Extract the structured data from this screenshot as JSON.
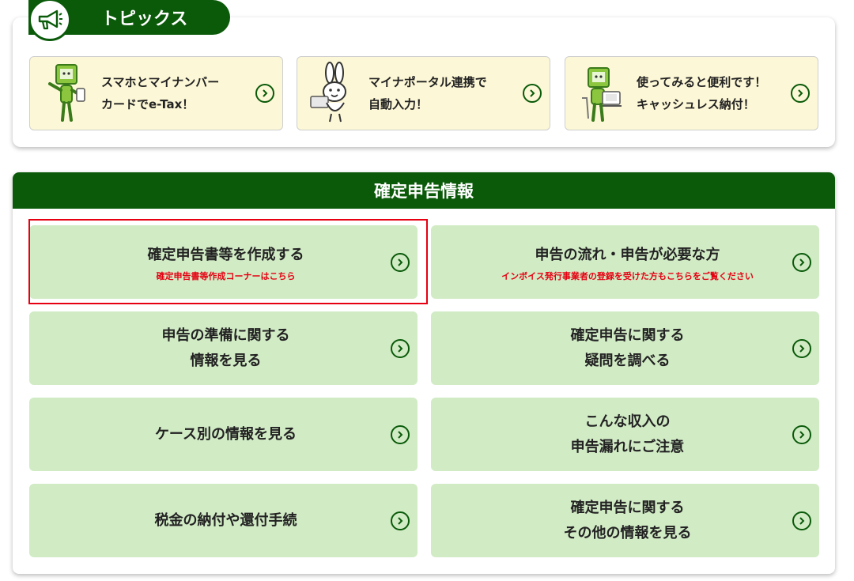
{
  "topics": {
    "title": "トピックス",
    "cards": [
      {
        "text": "スマホとマイナンバー\nカードでe-Tax！",
        "icon": "smartphone-mascot-icon"
      },
      {
        "text": "マイナポータル連携で\n自動入力！",
        "icon": "rabbit-card-mascot-icon"
      },
      {
        "text": "使ってみると便利です！\nキャッシュレス納付！",
        "icon": "computer-mascot-icon"
      }
    ]
  },
  "info": {
    "title": "確定申告情報",
    "cards": [
      {
        "label": "確定申告書等を作成する",
        "sub": "確定申告書等作成コーナーはこちら"
      },
      {
        "label": "申告の流れ・申告が必要な方",
        "sub": "インボイス発行事業者の登録を受けた方もこちらをご覧ください"
      },
      {
        "label": "申告の準備に関する\n情報を見る",
        "sub": ""
      },
      {
        "label": "確定申告に関する\n疑問を調べる",
        "sub": ""
      },
      {
        "label": "ケース別の情報を見る",
        "sub": ""
      },
      {
        "label": "こんな収入の\n申告漏れにご注意",
        "sub": ""
      },
      {
        "label": "税金の納付や還付手続",
        "sub": ""
      },
      {
        "label": "確定申告に関する\nその他の情報を見る",
        "sub": ""
      }
    ]
  },
  "colors": {
    "accent_green": "#0a5a0a",
    "card_green": "#d1ebc5",
    "topic_yellow": "#fcf7d6",
    "highlight_red": "#e60012"
  }
}
